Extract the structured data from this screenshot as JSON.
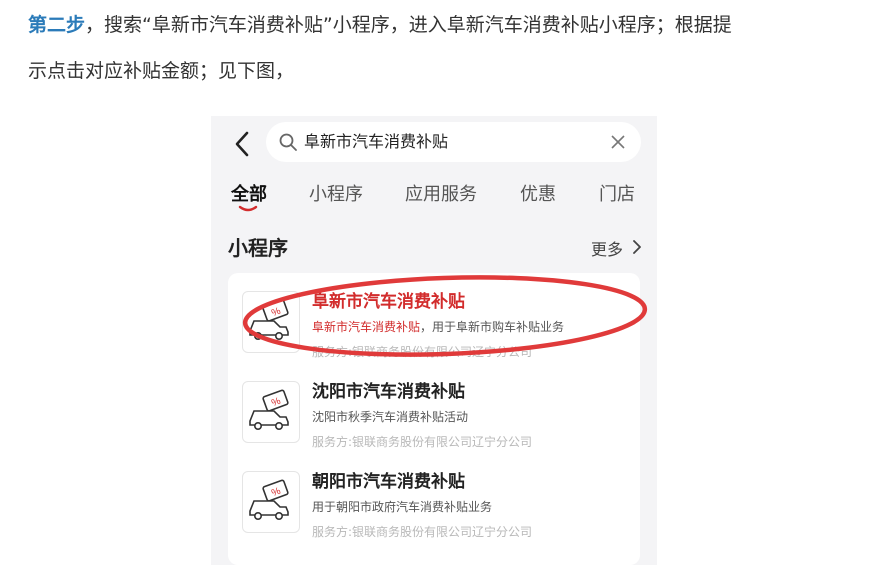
{
  "instruction": {
    "step_label": "第二步",
    "line1_rest": "，搜索“阜新市汽车消费补贴”小程序，进入阜新汽车消费补贴小程序；根据提",
    "line2": "示点击对应补贴金额；见下图，"
  },
  "search": {
    "query": "阜新市汽车消费补贴"
  },
  "tabs": [
    "全部",
    "小程序",
    "应用服务",
    "优惠",
    "门店"
  ],
  "active_tab": "全部",
  "section": {
    "title": "小程序",
    "more": "更多"
  },
  "results": [
    {
      "name": "阜新市汽车消费补贴",
      "desc_highlight": "阜新市汽车消费补贴",
      "desc_rest": "，用于阜新市购车补贴业务",
      "provider": "服务方:银联商务股份有限公司辽宁分公司"
    },
    {
      "name": "沈阳市汽车消费补贴",
      "desc_highlight": "",
      "desc_rest": "沈阳市秋季汽车消费补贴活动",
      "provider": "服务方:银联商务股份有限公司辽宁分公司"
    },
    {
      "name": "朝阳市汽车消费补贴",
      "desc_highlight": "",
      "desc_rest": "用于朝阳市政府汽车消费补贴业务",
      "provider": "服务方:银联商务股份有限公司辽宁分公司"
    }
  ],
  "colors": {
    "step": "#2b7bb9",
    "highlight": "#d22c2c",
    "annotation_circle": "#e03a3a"
  },
  "icons": {
    "back": "chevron-left-icon",
    "search": "search-icon",
    "clear": "close-icon",
    "more": "chevron-right-icon",
    "app_logo": "car-coupon-icon"
  }
}
